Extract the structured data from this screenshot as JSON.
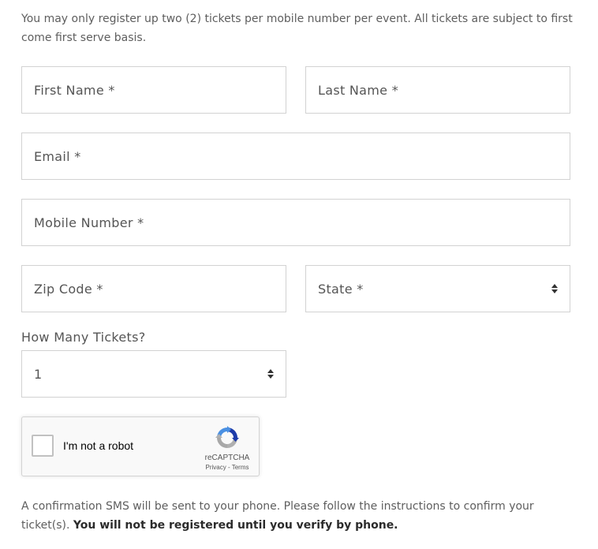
{
  "intro_text": "You may only register up two (2) tickets per mobile number per event. All tickets are subject to first come first serve basis.",
  "form": {
    "first_name_placeholder": "First Name *",
    "last_name_placeholder": "Last Name *",
    "email_placeholder": "Email *",
    "mobile_placeholder": "Mobile Number *",
    "zip_placeholder": "Zip Code *",
    "state_selected": "State *",
    "tickets_label": "How Many Tickets?",
    "tickets_selected": "1"
  },
  "recaptcha": {
    "label": "I'm not a robot",
    "brand": "reCAPTCHA",
    "privacy_link": "Privacy",
    "separator": " - ",
    "terms_link": "Terms"
  },
  "confirmation": {
    "text": "A confirmation SMS will be sent to your phone. Please follow the instructions to confirm your ticket(s). ",
    "bold_text": "You will not be registered until you verify by phone."
  },
  "colors": {
    "border": "#d2d2d2",
    "text": "#555555",
    "recaptcha_blue": "#4a90e2",
    "recaptcha_gray": "#b0b0b0"
  }
}
